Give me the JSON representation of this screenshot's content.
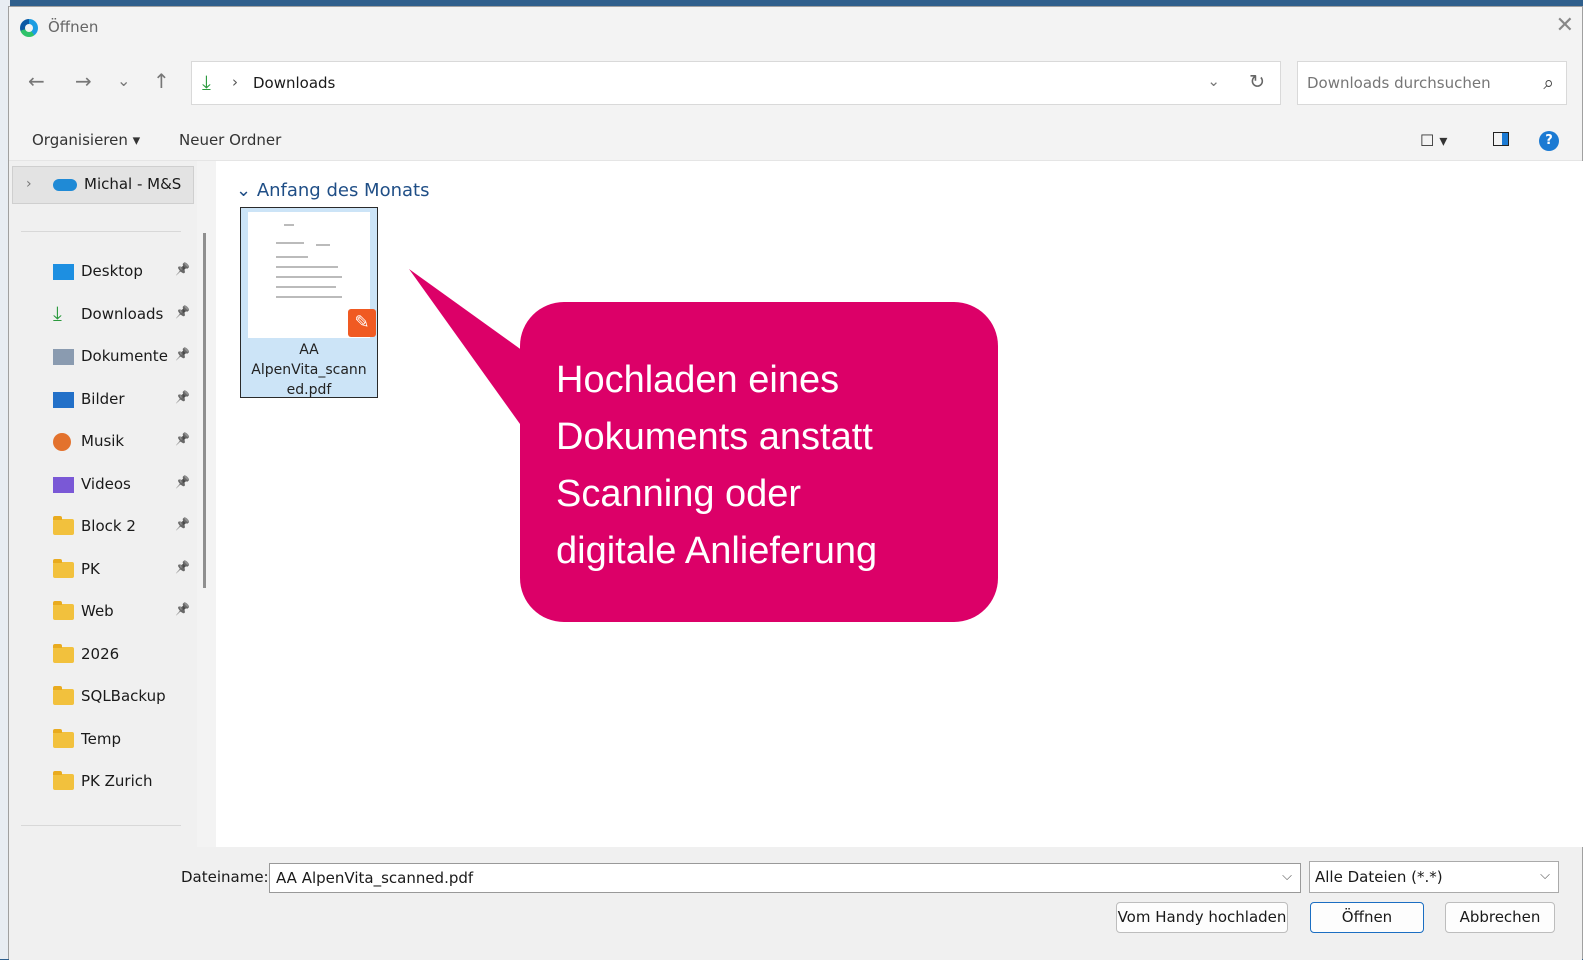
{
  "window": {
    "title": "Öffnen"
  },
  "navigation": {
    "back": "←",
    "forward": "→",
    "recent": "⌄",
    "up": "↑"
  },
  "address": {
    "location": "Downloads",
    "separator": "›"
  },
  "search": {
    "placeholder": "Downloads durchsuchen"
  },
  "toolbar": {
    "organize": "Organisieren ▾",
    "new_folder": "Neuer Ordner",
    "help": "?"
  },
  "sidebar": {
    "top_item": "Michal - M&S",
    "items": [
      {
        "label": "Desktop",
        "icon": "desktop-icon",
        "pinned": true
      },
      {
        "label": "Downloads",
        "icon": "download-icon",
        "pinned": true
      },
      {
        "label": "Dokumente",
        "icon": "documents-icon",
        "pinned": true
      },
      {
        "label": "Bilder",
        "icon": "pictures-icon",
        "pinned": true
      },
      {
        "label": "Musik",
        "icon": "music-icon",
        "pinned": true
      },
      {
        "label": "Videos",
        "icon": "videos-icon",
        "pinned": true
      },
      {
        "label": "Block 2",
        "icon": "folder-icon",
        "pinned": true
      },
      {
        "label": "PK",
        "icon": "folder-shortcut-icon",
        "pinned": true
      },
      {
        "label": "Web",
        "icon": "folder-icon",
        "pinned": true
      },
      {
        "label": "2026",
        "icon": "folder-icon",
        "pinned": false
      },
      {
        "label": "SQLBackup",
        "icon": "folder-icon",
        "pinned": false
      },
      {
        "label": "Temp",
        "icon": "folder-icon",
        "pinned": false
      },
      {
        "label": "PK Zurich",
        "icon": "folder-icon",
        "pinned": false
      }
    ]
  },
  "content": {
    "group_header": "Anfang des Monats",
    "files": [
      {
        "name": "AA AlpenVita_scanned.pdf",
        "name_display": "AA AlpenVita_scann ed.pdf",
        "selected": true
      }
    ]
  },
  "callout": {
    "lines": [
      "Hochladen eines",
      "Dokuments anstatt",
      "Scanning oder",
      "digitale Anlieferung"
    ],
    "color": "#dc0068"
  },
  "footer": {
    "filename_label": "Dateiname:",
    "filename_value": "AA AlpenVita_scanned.pdf",
    "filetype_value": "Alle Dateien (*.*)",
    "buttons": {
      "phone_upload": "Vom Handy hochladen",
      "open": "Öffnen",
      "cancel": "Abbrechen"
    }
  }
}
